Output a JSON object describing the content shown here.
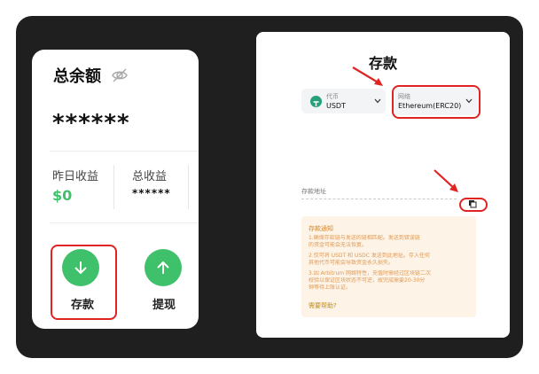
{
  "wallet": {
    "title": "总余额",
    "balance_masked": "******",
    "yesterday_label": "昨日收益",
    "yesterday_value": "$0",
    "total_label": "总收益",
    "total_value": "******",
    "deposit_label": "存款",
    "withdraw_label": "提现"
  },
  "deposit": {
    "title": "存款",
    "currency_label": "代币",
    "currency_value": "USDT",
    "network_label": "网络",
    "network_value": "Ethereum(ERC20)",
    "address_label": "存款地址",
    "notice": {
      "title": "存款通知",
      "lines": [
        "1.确保存款链与发送的链相匹配。发送到错误链",
        "的资金可能会无法恢复。",
        "2.仅可将 USDT 和 USDC 发送到此地址。存入任何",
        "其他代币可能会导致资金永久损失。",
        "3.因 Arbitrum 网络特性，充值时需经过区块链二次",
        "校验以保证区块状态不可逆，故完成需要20-30分",
        "钟等待上账认证。"
      ],
      "help": "需要帮助?"
    }
  },
  "colors": {
    "accent_green": "#3fc06a",
    "highlight_red": "#e02424",
    "frame_dark": "#1f1f1f",
    "notice_bg": "#fdf3e6"
  },
  "icons": [
    "eye-off-icon",
    "arrow-down-icon",
    "arrow-up-icon",
    "usdt-icon",
    "chevron-down-icon",
    "copy-icon"
  ]
}
